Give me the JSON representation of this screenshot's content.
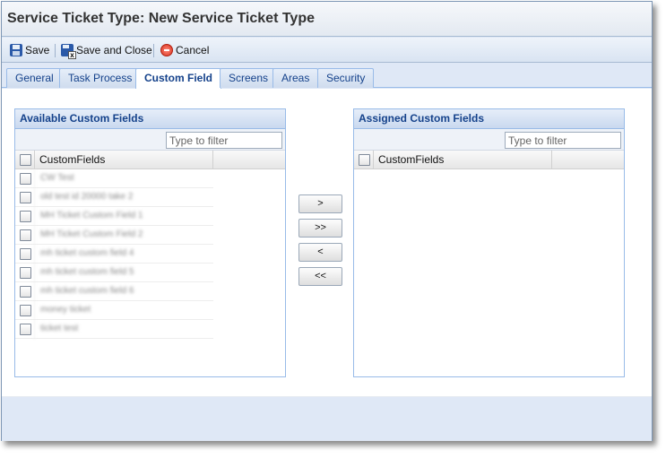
{
  "window": {
    "title": "Service Ticket Type: New Service Ticket Type"
  },
  "toolbar": {
    "save_label": "Save",
    "save_close_label": "Save and Close",
    "cancel_label": "Cancel"
  },
  "tabs": [
    {
      "label": "General",
      "active": false
    },
    {
      "label": "Task Process",
      "active": false
    },
    {
      "label": "Custom Field",
      "active": true
    },
    {
      "label": "Screens",
      "active": false
    },
    {
      "label": "Areas",
      "active": false
    },
    {
      "label": "Security",
      "active": false
    }
  ],
  "available": {
    "title": "Available Custom Fields",
    "filter_placeholder": "Type to filter",
    "column_header": "CustomFields",
    "rows": [
      "CW Test",
      "old test id 20000 take 2",
      "MH Ticket Custom Field 1",
      "MH Ticket Custom Field 2",
      "mh ticket custom field 4",
      "mh ticket custom field 5",
      "mh ticket custom field 6",
      "money ticket",
      "ticket test"
    ]
  },
  "assigned": {
    "title": "Assigned Custom Fields",
    "filter_placeholder": "Type to filter",
    "column_header": "CustomFields",
    "rows": []
  },
  "move_buttons": {
    "add": ">",
    "add_all": ">>",
    "remove": "<",
    "remove_all": "<<"
  },
  "colors": {
    "accent_text": "#15428b",
    "panel_border": "#99bbe8",
    "window_bg": "#dfe8f6"
  }
}
